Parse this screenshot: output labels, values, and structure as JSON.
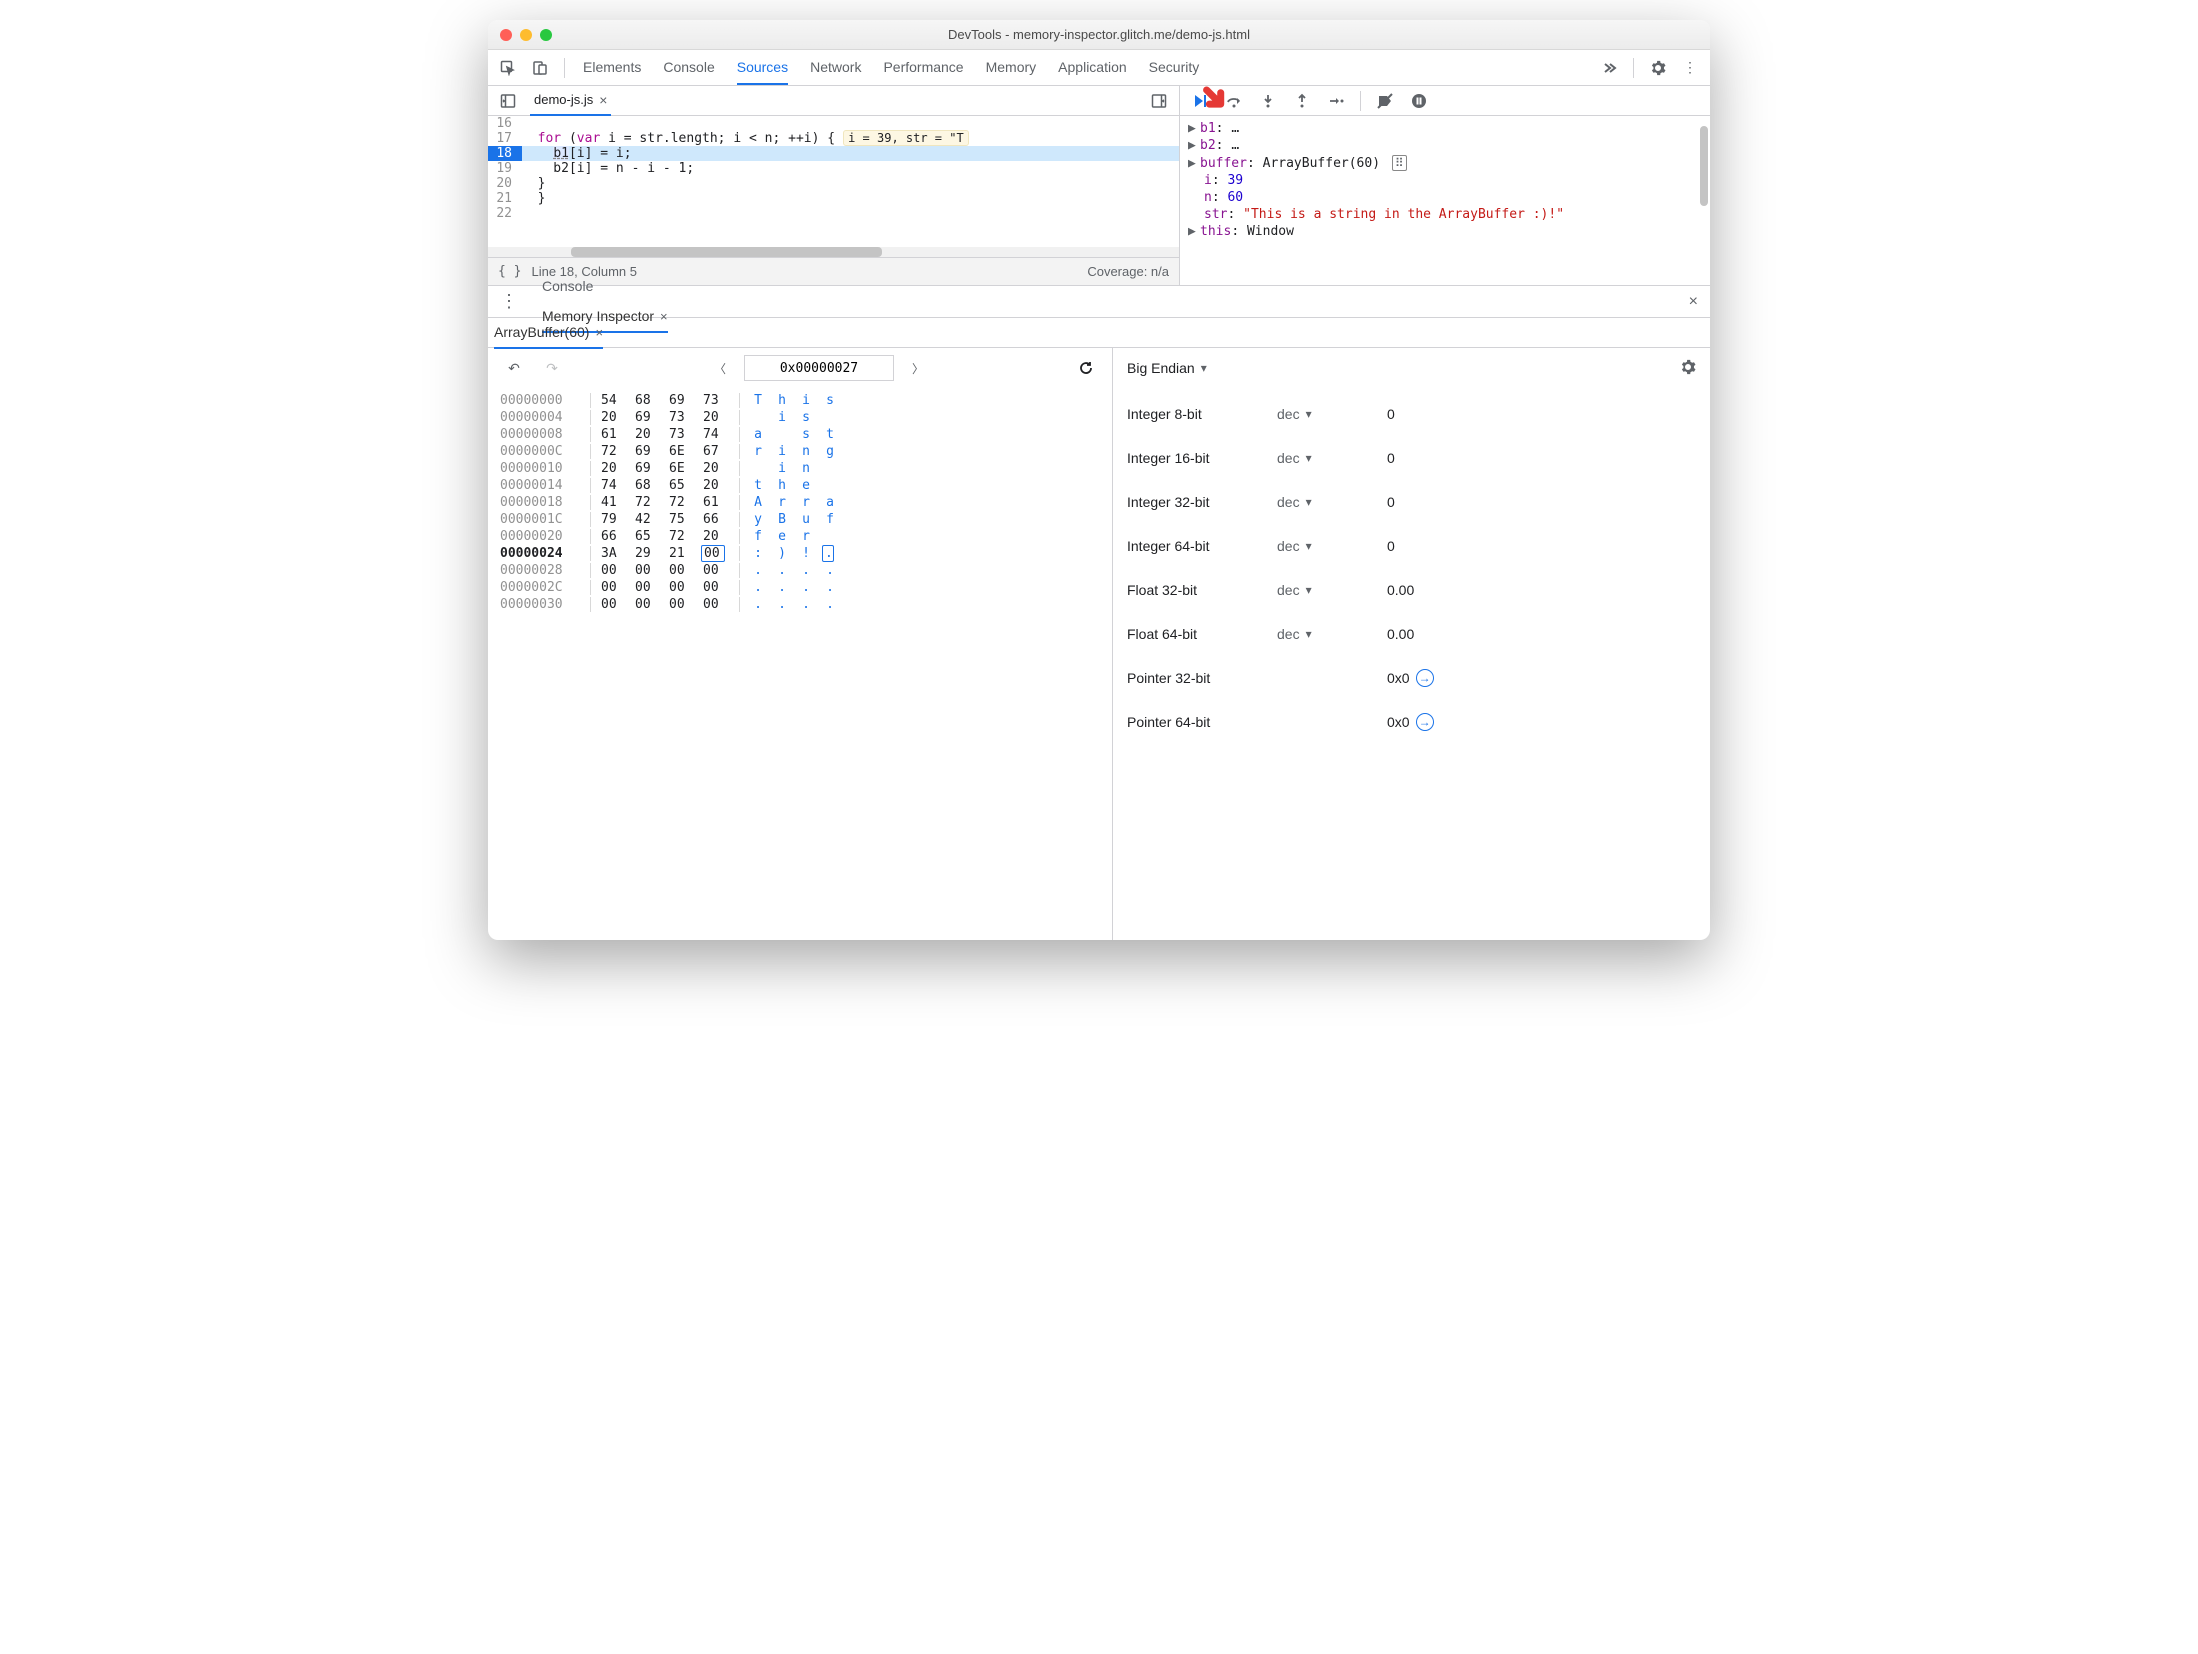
{
  "window": {
    "title": "DevTools - memory-inspector.glitch.me/demo-js.html"
  },
  "main_tabs": [
    "Elements",
    "Console",
    "Sources",
    "Network",
    "Performance",
    "Memory",
    "Application",
    "Security"
  ],
  "main_active": "Sources",
  "editor": {
    "tab": "demo-js.js",
    "lines": [
      {
        "n": 16,
        "text": ""
      },
      {
        "n": 17,
        "text": "for (var i = str.length; i < n; ++i) {"
      },
      {
        "n": 18,
        "text": "  b1[i] = i;",
        "hl": true
      },
      {
        "n": 19,
        "text": "  b2[i] = n - i - 1;"
      },
      {
        "n": 20,
        "text": "}"
      },
      {
        "n": 21,
        "text": "}"
      },
      {
        "n": 22,
        "text": ""
      }
    ],
    "inline_hint": "i = 39, str = \"T",
    "status_left": "Line 18, Column 5",
    "status_right": "Coverage: n/a"
  },
  "scope": {
    "b1": "…",
    "b2": "…",
    "buffer_label": "buffer",
    "buffer_type": "ArrayBuffer(60)",
    "i_label": "i",
    "i": "39",
    "n_label": "n",
    "n": "60",
    "str_label": "str",
    "str": "\"This is a string in the ArrayBuffer :)!\"",
    "this_label": "this",
    "this": "Window"
  },
  "drawer": {
    "tabs": [
      "Console",
      "Memory Inspector"
    ],
    "active": "Memory Inspector",
    "subtab": "ArrayBuffer(60)"
  },
  "hex": {
    "address": "0x00000027",
    "rows": [
      {
        "addr": "00000000",
        "b": [
          "54",
          "68",
          "69",
          "73"
        ],
        "a": [
          "T",
          "h",
          "i",
          "s"
        ]
      },
      {
        "addr": "00000004",
        "b": [
          "20",
          "69",
          "73",
          "20"
        ],
        "a": [
          "",
          "i",
          "s",
          ""
        ]
      },
      {
        "addr": "00000008",
        "b": [
          "61",
          "20",
          "73",
          "74"
        ],
        "a": [
          "a",
          "",
          "s",
          "t"
        ]
      },
      {
        "addr": "0000000C",
        "b": [
          "72",
          "69",
          "6E",
          "67"
        ],
        "a": [
          "r",
          "i",
          "n",
          "g"
        ]
      },
      {
        "addr": "00000010",
        "b": [
          "20",
          "69",
          "6E",
          "20"
        ],
        "a": [
          "",
          "i",
          "n",
          ""
        ]
      },
      {
        "addr": "00000014",
        "b": [
          "74",
          "68",
          "65",
          "20"
        ],
        "a": [
          "t",
          "h",
          "e",
          ""
        ]
      },
      {
        "addr": "00000018",
        "b": [
          "41",
          "72",
          "72",
          "61"
        ],
        "a": [
          "A",
          "r",
          "r",
          "a"
        ]
      },
      {
        "addr": "0000001C",
        "b": [
          "79",
          "42",
          "75",
          "66"
        ],
        "a": [
          "y",
          "B",
          "u",
          "f"
        ]
      },
      {
        "addr": "00000020",
        "b": [
          "66",
          "65",
          "72",
          "20"
        ],
        "a": [
          "f",
          "e",
          "r",
          ""
        ]
      },
      {
        "addr": "00000024",
        "b": [
          "3A",
          "29",
          "21",
          "00"
        ],
        "a": [
          ":",
          ")",
          "!",
          "."
        ],
        "bold": true,
        "selIdx": 3
      },
      {
        "addr": "00000028",
        "b": [
          "00",
          "00",
          "00",
          "00"
        ],
        "a": [
          ".",
          ".",
          ".",
          "."
        ]
      },
      {
        "addr": "0000002C",
        "b": [
          "00",
          "00",
          "00",
          "00"
        ],
        "a": [
          ".",
          ".",
          ".",
          "."
        ]
      },
      {
        "addr": "00000030",
        "b": [
          "00",
          "00",
          "00",
          "00"
        ],
        "a": [
          ".",
          ".",
          ".",
          "."
        ]
      }
    ]
  },
  "values": {
    "endian": "Big Endian",
    "rows": [
      {
        "type": "Integer 8-bit",
        "mode": "dec",
        "val": "0"
      },
      {
        "type": "Integer 16-bit",
        "mode": "dec",
        "val": "0"
      },
      {
        "type": "Integer 32-bit",
        "mode": "dec",
        "val": "0"
      },
      {
        "type": "Integer 64-bit",
        "mode": "dec",
        "val": "0"
      },
      {
        "type": "Float 32-bit",
        "mode": "dec",
        "val": "0.00"
      },
      {
        "type": "Float 64-bit",
        "mode": "dec",
        "val": "0.00"
      },
      {
        "type": "Pointer 32-bit",
        "mode": "",
        "val": "0x0",
        "jump": true
      },
      {
        "type": "Pointer 64-bit",
        "mode": "",
        "val": "0x0",
        "jump": true
      }
    ]
  }
}
